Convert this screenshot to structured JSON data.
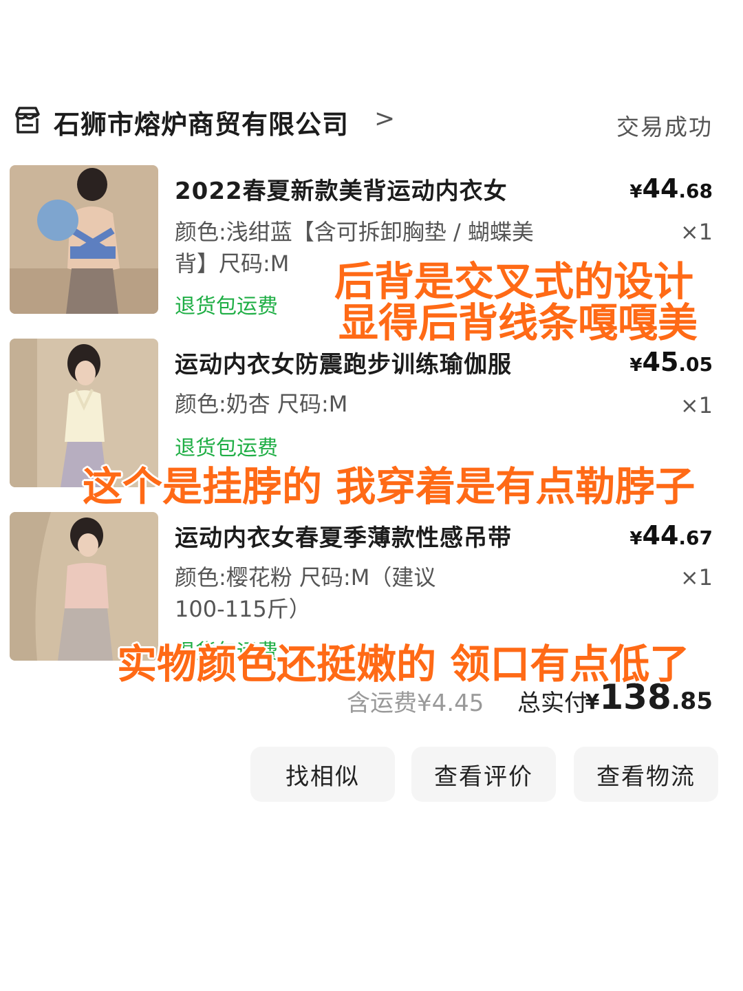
{
  "store": {
    "name": "石狮市熔炉商贸有限公司",
    "chevron": ">",
    "status": "交易成功"
  },
  "items": [
    {
      "title": "2022春夏新款美背运动内衣女",
      "price_currency": "¥",
      "price_int": "44",
      "price_dec": ".68",
      "spec": "颜色:浅绀蓝【含可拆卸胸垫 / 蝴蝶美背】尺码:M",
      "qty": "×1",
      "badge": "退货包运费"
    },
    {
      "title": "运动内衣女防震跑步训练瑜伽服",
      "price_currency": "¥",
      "price_int": "45",
      "price_dec": ".05",
      "spec": "颜色:奶杏 尺码:M",
      "qty": "×1",
      "badge": "退货包运费"
    },
    {
      "title": "运动内衣女春夏季薄款性感吊带",
      "price_currency": "¥",
      "price_int": "44",
      "price_dec": ".67",
      "spec": "颜色:樱花粉 尺码:M（建议100-115斤）",
      "qty": "×1",
      "badge": "退货包运费"
    }
  ],
  "totals": {
    "shipping": "含运费¥4.45",
    "label": "总实付",
    "currency": "¥",
    "int": "138",
    "dec": ".85"
  },
  "actions": {
    "find_similar": "找相似",
    "view_review": "查看评价",
    "view_logistics": "查看物流"
  },
  "captions": {
    "c1_line1": "后背是交叉式的设计",
    "c1_line2": "显得后背线条嘎嘎美",
    "c2": "这个是挂脖的 我穿着是有点勒脖子",
    "c3": "实物颜色还挺嫩的 领口有点低了"
  },
  "colors": {
    "overlay_text": "#ff6a16",
    "badge_green": "#1fae45",
    "button_bg": "#f5f5f5"
  }
}
